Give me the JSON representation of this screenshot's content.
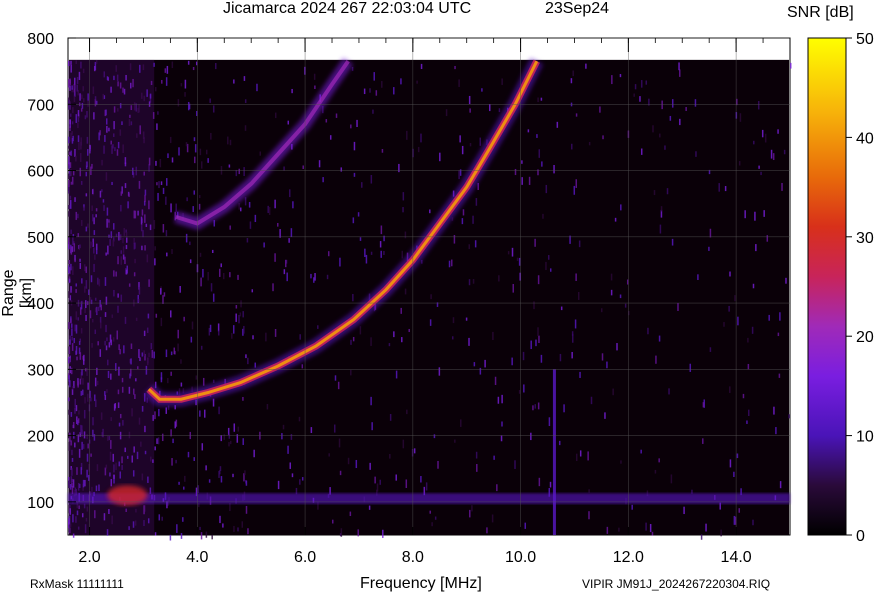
{
  "header": {
    "title": "Jicamarca 2024 267 22:03:04 UTC",
    "date": "23Sep24"
  },
  "footer": {
    "rxmask": "RxMask 11111111",
    "file": "VIPIR  JM91J_2024267220304.RIQ"
  },
  "chart_data": {
    "type": "heatmap",
    "title": "Jicamarca 2024 267 22:03:04 UTC",
    "xlabel": "Frequency [MHz]",
    "ylabel": "Range [km]",
    "xlim": [
      1.6,
      15.0
    ],
    "ylim": [
      50,
      800
    ],
    "x_ticks": [
      "2.0",
      "4.0",
      "6.0",
      "8.0",
      "10.0",
      "12.0",
      "14.0"
    ],
    "y_ticks": [
      "100",
      "200",
      "300",
      "400",
      "500",
      "600",
      "700",
      "800"
    ],
    "grid": true,
    "colorbar": {
      "label": "SNR [dB]",
      "range": [
        0,
        50
      ],
      "ticks": [
        "0",
        "10",
        "20",
        "30",
        "40",
        "50"
      ],
      "colors": [
        "#000000",
        "#3a0a4a",
        "#5a18c8",
        "#8a2be2",
        "#b0279a",
        "#d2262a",
        "#e65a10",
        "#f59a0a",
        "#ffd400",
        "#ffff00"
      ]
    },
    "traces": [
      {
        "name": "F-region trace",
        "points": [
          [
            3.1,
            270
          ],
          [
            3.3,
            255
          ],
          [
            3.7,
            255
          ],
          [
            4.2,
            265
          ],
          [
            4.8,
            280
          ],
          [
            5.5,
            305
          ],
          [
            6.2,
            335
          ],
          [
            6.9,
            375
          ],
          [
            7.5,
            420
          ],
          [
            8.0,
            465
          ],
          [
            8.5,
            520
          ],
          [
            9.0,
            575
          ],
          [
            9.4,
            630
          ],
          [
            9.9,
            700
          ],
          [
            10.3,
            765
          ]
        ]
      },
      {
        "name": "multiple echo",
        "points": [
          [
            3.6,
            530
          ],
          [
            4.0,
            520
          ],
          [
            4.5,
            545
          ],
          [
            5.0,
            580
          ],
          [
            5.5,
            625
          ],
          [
            6.0,
            670
          ],
          [
            6.5,
            730
          ],
          [
            6.8,
            765
          ]
        ]
      }
    ],
    "e_layer_band": {
      "range_km": 105,
      "freq_range": [
        1.6,
        15.0
      ]
    }
  }
}
